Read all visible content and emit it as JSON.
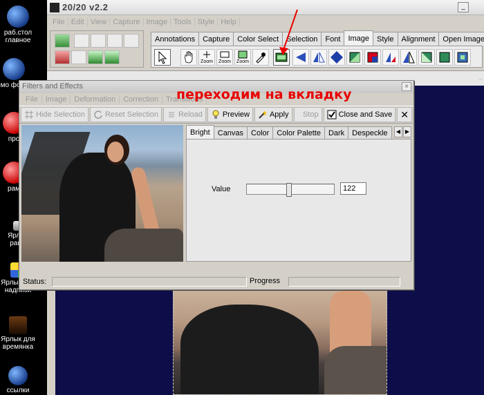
{
  "app": {
    "title": "20/20 v2.2",
    "menu": [
      "File",
      "Edit",
      "View",
      "Capture",
      "Image",
      "Tools",
      "Style",
      "Help"
    ],
    "tabs": [
      {
        "label": "Annotations",
        "active": false
      },
      {
        "label": "Capture",
        "active": false
      },
      {
        "label": "Color Select",
        "active": false
      },
      {
        "label": "Selection",
        "active": false
      },
      {
        "label": "Font",
        "active": false
      },
      {
        "label": "Image",
        "active": true
      },
      {
        "label": "Style",
        "active": false
      },
      {
        "label": "Alignment",
        "active": false
      },
      {
        "label": "Open Images",
        "active": false
      }
    ],
    "tools": [
      {
        "name": "select-arrow-icon",
        "label": ""
      },
      {
        "name": "pan-hand-icon",
        "label": ""
      },
      {
        "name": "zoom-in-icon",
        "label": "Zoom"
      },
      {
        "name": "zoom-out-icon",
        "label": "Zoom"
      },
      {
        "name": "zoom-fit-icon",
        "label": "Zoom"
      },
      {
        "name": "eyedropper-icon",
        "label": ""
      },
      {
        "name": "filters-icon",
        "label": ""
      },
      {
        "name": "flip-left-icon",
        "label": ""
      },
      {
        "name": "mirror-icon",
        "label": ""
      },
      {
        "name": "rotate-icon",
        "label": ""
      },
      {
        "name": "gradient-icon",
        "label": ""
      },
      {
        "name": "color-swatch-icon",
        "label": ""
      },
      {
        "name": "sharpen-icon",
        "label": ""
      },
      {
        "name": "contrast-icon",
        "label": ""
      },
      {
        "name": "emboss-icon",
        "label": ""
      }
    ]
  },
  "dialog": {
    "title": "Filters and Effects",
    "menu": [
      "File",
      "Image",
      "Deformation",
      "Correction",
      "Transitions"
    ],
    "buttons": {
      "hide_selection": "Hide Selection",
      "reset_selection": "Reset Selection",
      "reload": "Reload",
      "preview": "Preview",
      "apply": "Apply",
      "stop": "Stop",
      "close_save": "Close and Save",
      "close": "✕"
    },
    "filter_tabs": [
      {
        "label": "Bright",
        "active": true
      },
      {
        "label": "Canvas",
        "active": false
      },
      {
        "label": "Color",
        "active": false
      },
      {
        "label": "Color Palette",
        "active": false
      },
      {
        "label": "Dark",
        "active": false
      },
      {
        "label": "Despeckle",
        "active": false
      }
    ],
    "value_label": "Value",
    "value": "122",
    "slider_fraction": 0.48,
    "status_label": "Status:",
    "progress_label": "Progress"
  },
  "annotation": {
    "text": "переходим на вкладку",
    "color": "#e80000"
  },
  "desktop_icons": [
    {
      "name": "desktop-icon-rabstol",
      "label": "раб.стол главное"
    },
    {
      "name": "desktop-icon-foto",
      "label": "мо фото"
    },
    {
      "name": "desktop-icon-pro",
      "label": "про"
    },
    {
      "name": "desktop-icon-ramki",
      "label": "рам"
    },
    {
      "name": "desktop-icon-shortcut-ramki",
      "label": "Ярлык рамо"
    },
    {
      "name": "desktop-icon-shortcut-nadpisi",
      "label": "Ярлык для надписи"
    },
    {
      "name": "desktop-icon-shortcut-vremyanka",
      "label": "Ярлык для времянка"
    },
    {
      "name": "desktop-icon-ssylki",
      "label": "ссылки"
    }
  ]
}
